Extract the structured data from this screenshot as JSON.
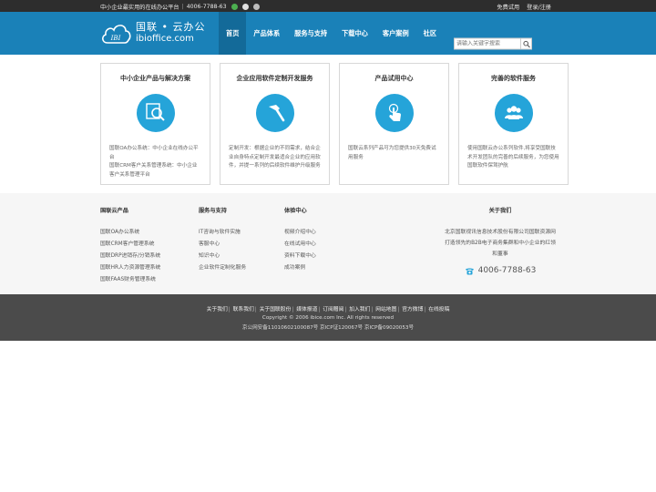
{
  "topbar": {
    "tagline": "中小企业最实用的在线办公平台",
    "phone": "4006-7788-63",
    "free_trial": "免费试用",
    "login": "登录/注册"
  },
  "logo": {
    "cn": "国联 • 云办公",
    "en": "ibioffice.com",
    "mark": "IBI"
  },
  "nav": {
    "items": [
      "首页",
      "产品体系",
      "服务与支持",
      "下载中心",
      "客户案例",
      "社区"
    ]
  },
  "search": {
    "placeholder": "请输入关键字搜索"
  },
  "cards": [
    {
      "title": "中小企业产品与解决方案",
      "icon": "search-icon",
      "lines": [
        "国联OA办公系统：中小企业在线办公平台",
        "国联CRM客户关系管理系统：中小企业客户关系管理平台"
      ]
    },
    {
      "title": "企业应用软件定制开发服务",
      "icon": "hammer-icon",
      "lines": [
        "定制开发：根据企业的不同需求，结合企业自身特点定制开发最适合企业的应用软件，并提一系列的后续软件维护升级服务"
      ]
    },
    {
      "title": "产品试用中心",
      "icon": "touch-icon",
      "lines": [
        "国联云系列产品可为您提供30天免费试用服务"
      ]
    },
    {
      "title": "完善的软件服务",
      "icon": "users-icon",
      "lines": [
        "使用国联云办公系列软件,将享受国联技术开发团队的完善的后续服务，为您使用国联软件保驾护航"
      ]
    }
  ],
  "footer": {
    "products": {
      "title": "国联云产品",
      "items": [
        "国联OA办公系统",
        "国联CRM客户管理系统",
        "国联DRP进销存/分销系统",
        "国联HR人力资源管理系统",
        "国联FAAS财务管理系统"
      ]
    },
    "service": {
      "title": "服务与支持",
      "items": [
        "IT咨询与软件实施",
        "客服中心",
        "知识中心",
        "企业软件定制化服务"
      ]
    },
    "experience": {
      "title": "体验中心",
      "items": [
        "视频介绍中心",
        "在线试用中心",
        "资料下载中心",
        "成功案例"
      ]
    },
    "about": {
      "title": "关于我们",
      "desc": "北京国联视讯信息技术股份有限公司国联资源网打造领先的B2B电子商务集群和中小企业的红领和董事",
      "phone": "4006-7788-63"
    }
  },
  "bottom": {
    "links": [
      "关于我们",
      "联系我们",
      "关于国联股份",
      "媒体报道",
      "订阅赠阅",
      "加入我们",
      "网站地图",
      "官方微博",
      "在线投稿"
    ],
    "copyright": "Copyright © 2006 ibice.com Inc. All rights reserved",
    "icp": "京公网安备110106021000​87号 京ICP证120067号 京ICP备09020053号"
  },
  "colors": {
    "header_blue": "#1a81b8",
    "nav_active": "#136a99",
    "icon_blue": "#25a4d9",
    "topbar_dark": "#2d2d2d",
    "bottom_dark": "#4b4b4b"
  }
}
